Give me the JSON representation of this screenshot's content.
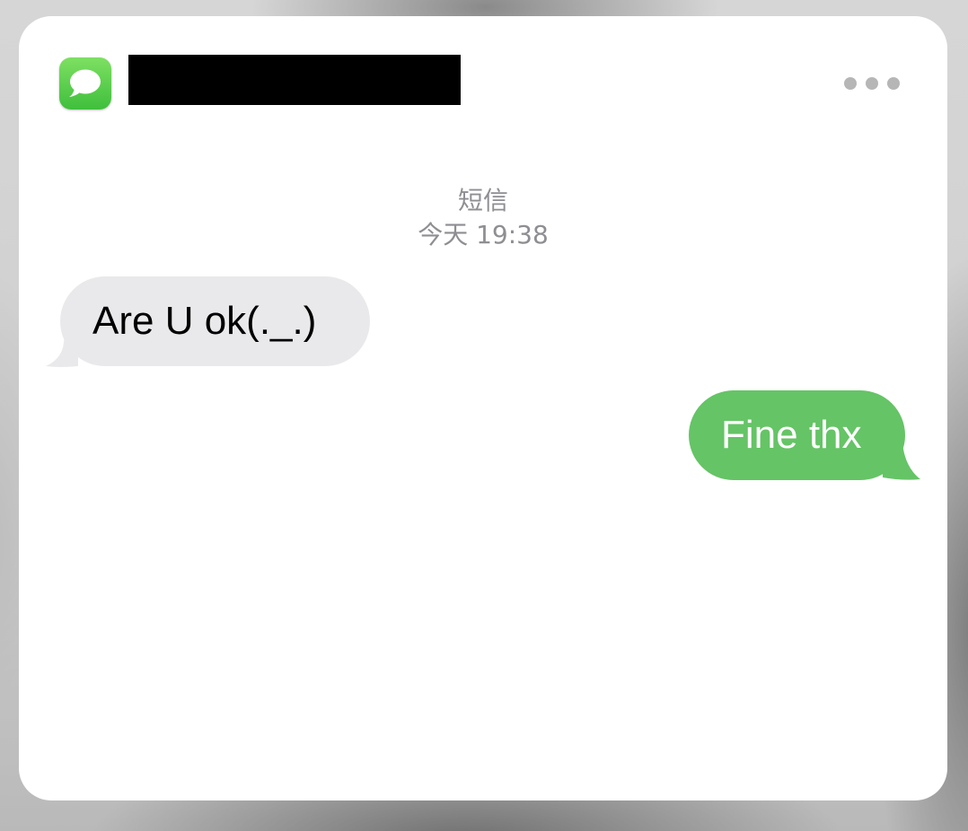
{
  "app": {
    "icon": "messages-icon",
    "accent_color": "#65c466"
  },
  "header": {
    "more_icon": "more-horizontal-icon"
  },
  "conversation": {
    "service_label": "短信",
    "timestamp": "今天 19:38",
    "messages": [
      {
        "direction": "incoming",
        "text": "Are U ok(._.)",
        "bubble_color": "#e9e9eb"
      },
      {
        "direction": "outgoing",
        "text": "Fine thx",
        "bubble_color": "#65c466"
      }
    ]
  }
}
